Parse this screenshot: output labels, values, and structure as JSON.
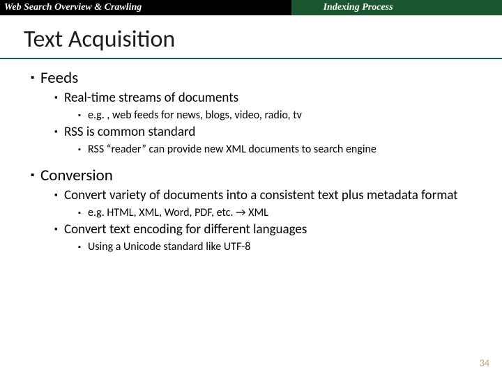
{
  "header": {
    "left": "Web Search Overview & Crawling",
    "right": "Indexing Process"
  },
  "title": "Text Acquisition",
  "bullets": [
    {
      "text": "Feeds",
      "children": [
        {
          "text": "Real-time streams of documents",
          "children": [
            {
              "text": "e.g. , web feeds for news, blogs, video, radio, tv"
            }
          ]
        },
        {
          "text": "RSS is common standard",
          "children": [
            {
              "text": "RSS “reader” can provide new XML documents to search engine"
            }
          ]
        }
      ]
    },
    {
      "text": "Conversion",
      "children": [
        {
          "text": "Convert variety of documents into a consistent text plus metadata format",
          "children": [
            {
              "text": "e.g. HTML, XML, Word, PDF, etc. → XML"
            }
          ]
        },
        {
          "text": "Convert text encoding for different languages",
          "children": [
            {
              "text": "Using a Unicode standard like UTF-8"
            }
          ]
        }
      ]
    }
  ],
  "page_number": "34"
}
